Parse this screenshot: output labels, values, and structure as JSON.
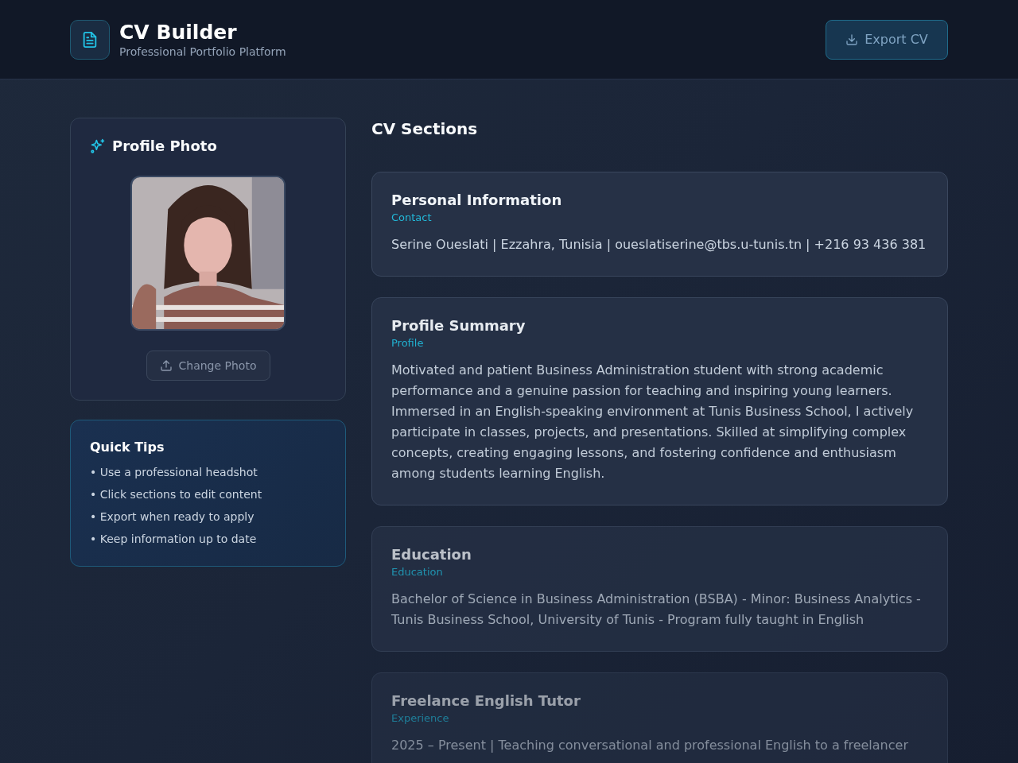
{
  "header": {
    "title": "CV Builder",
    "subtitle": "Professional Portfolio Platform",
    "export_button": "Export CV"
  },
  "profile_photo": {
    "title": "Profile Photo",
    "change_button": "Change Photo"
  },
  "quick_tips": {
    "title": "Quick Tips",
    "items": [
      "• Use a professional headshot",
      "• Click sections to edit content",
      "• Export when ready to apply",
      "• Keep information up to date"
    ]
  },
  "cv_sections": {
    "title": "CV Sections",
    "sections": [
      {
        "title": "Personal Information",
        "category": "Contact",
        "text": "Serine Oueslati | Ezzahra, Tunisia | oueslatiserine@tbs.u-tunis.tn | +216 93 436 381"
      },
      {
        "title": "Profile Summary",
        "category": "Profile",
        "text": "Motivated and patient Business Administration student with strong academic performance and a genuine passion for teaching and inspiring young learners. Immersed in an English-speaking environment at Tunis Business School, I actively participate in classes, projects, and presentations. Skilled at simplifying complex concepts, creating engaging lessons, and fostering confidence and enthusiasm among students learning English."
      },
      {
        "title": "Education",
        "category": "Education",
        "text": "Bachelor of Science in Business Administration (BSBA) - Minor: Business Analytics - Tunis Business School, University of Tunis - Program fully taught in English"
      },
      {
        "title": "Freelance English Tutor",
        "category": "Experience",
        "text": "2025 – Present | Teaching conversational and professional English to a freelancer"
      }
    ]
  }
}
